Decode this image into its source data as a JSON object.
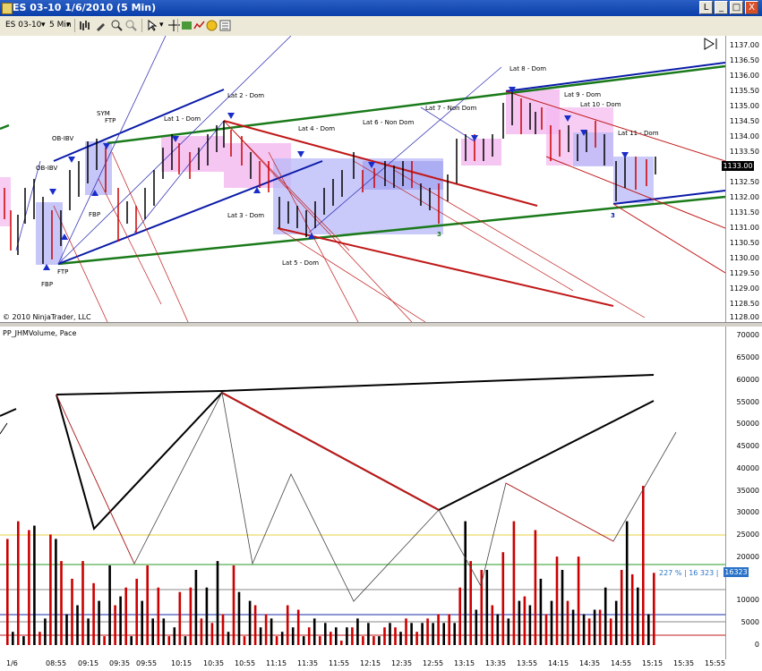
{
  "window": {
    "title": "ES 03-10  1/6/2010  (5 Min)",
    "buttons": [
      "L",
      "_",
      "□",
      "X"
    ]
  },
  "toolbar": {
    "instrument": "ES 03-10",
    "interval": "5 Min"
  },
  "price_panel": {
    "copyright": "© 2010 NinjaTrader, LLC",
    "last_price_label": "1133.00",
    "y_labels": [
      "1137.00",
      "1136.50",
      "1136.00",
      "1135.50",
      "1135.00",
      "1134.50",
      "1134.00",
      "1133.50",
      "1133.00",
      "1132.50",
      "1132.00",
      "1131.50",
      "1131.00",
      "1130.50",
      "1130.00",
      "1129.50",
      "1129.00",
      "1128.50",
      "1128.00"
    ],
    "annotations": [
      "Lat 1 - Dom",
      "Lat 2 - Dom",
      "Lat 3 - Dom",
      "Lat 4 - Dom",
      "Lat 5 - Dom",
      "Lat 6 - Non Dom",
      "Lat 7 - Non Dom",
      "Lat 8 - Dom",
      "Lat 9 - Dom",
      "Lat 10 - Dom",
      "Lat 11 - Dom",
      "OB-IBV",
      "OB-IBV",
      "SYM",
      "FTP",
      "FTP",
      "FBP",
      "FBP",
      "3",
      "3"
    ]
  },
  "volume_panel": {
    "label": "PP_JHMVolume, Pace",
    "pct_label": "227 % | 16 323 |",
    "last_volume_label": "16323",
    "y_labels": [
      "70000",
      "65000",
      "60000",
      "55000",
      "50000",
      "45000",
      "40000",
      "35000",
      "30000",
      "25000",
      "20000",
      "15000",
      "10000",
      "5000",
      "0"
    ]
  },
  "x_labels": [
    "1/6",
    "08:55",
    "09:15",
    "09:35",
    "09:55",
    "10:15",
    "10:35",
    "10:55",
    "11:15",
    "11:35",
    "11:55",
    "12:15",
    "12:35",
    "12:55",
    "13:15",
    "13:35",
    "13:55",
    "14:15",
    "14:35",
    "14:55",
    "15:15",
    "15:35",
    "15:55"
  ],
  "colors": {
    "bar_up": "#000000",
    "bar_down": "#cc0000",
    "trend_green": "#1a7a1a",
    "trend_blue": "#0a1aa8",
    "trend_red": "#c01818",
    "zone_blue": "#b8b8f8",
    "zone_pink": "#f4b8f0",
    "arrow": "#1a2cc8"
  },
  "chart_data": {
    "type": "bar",
    "volume_bars": [
      24000,
      3000,
      28000,
      2000,
      26000,
      27000,
      3000,
      6000,
      25000,
      24000,
      19000,
      7000,
      15000,
      9000,
      19000,
      6000,
      14000,
      10000,
      2000,
      18000,
      9000,
      11000,
      13000,
      2000,
      15000,
      10000,
      18000,
      6000,
      13000,
      6000,
      2000,
      4000,
      12000,
      2000,
      13000,
      17000,
      6000,
      13000,
      5000,
      19000,
      7000,
      3000,
      18000,
      12000,
      2000,
      10000,
      9000,
      4000,
      7000,
      6000,
      2000,
      3000,
      9000,
      4000,
      8000,
      2000,
      4000,
      6000,
      2000,
      5000,
      3000,
      4000,
      1000,
      4000,
      4000,
      6000,
      2000,
      5000,
      2000,
      2000,
      4000,
      5000,
      4000,
      3000,
      6000,
      5000,
      3000,
      5000,
      6000,
      5000,
      7000,
      5000,
      7000,
      5000,
      13000,
      28000,
      19000,
      8000,
      17000,
      17000,
      9000,
      7000,
      21000,
      6000,
      28000,
      10000,
      11000,
      9000,
      26000,
      15000,
      7000,
      10000,
      20000,
      17000,
      10000,
      8000,
      20000,
      7000,
      6000,
      8000,
      8000,
      13000,
      6000,
      10000,
      17000,
      28000,
      16000,
      13000,
      36000,
      7000,
      16323
    ]
  }
}
